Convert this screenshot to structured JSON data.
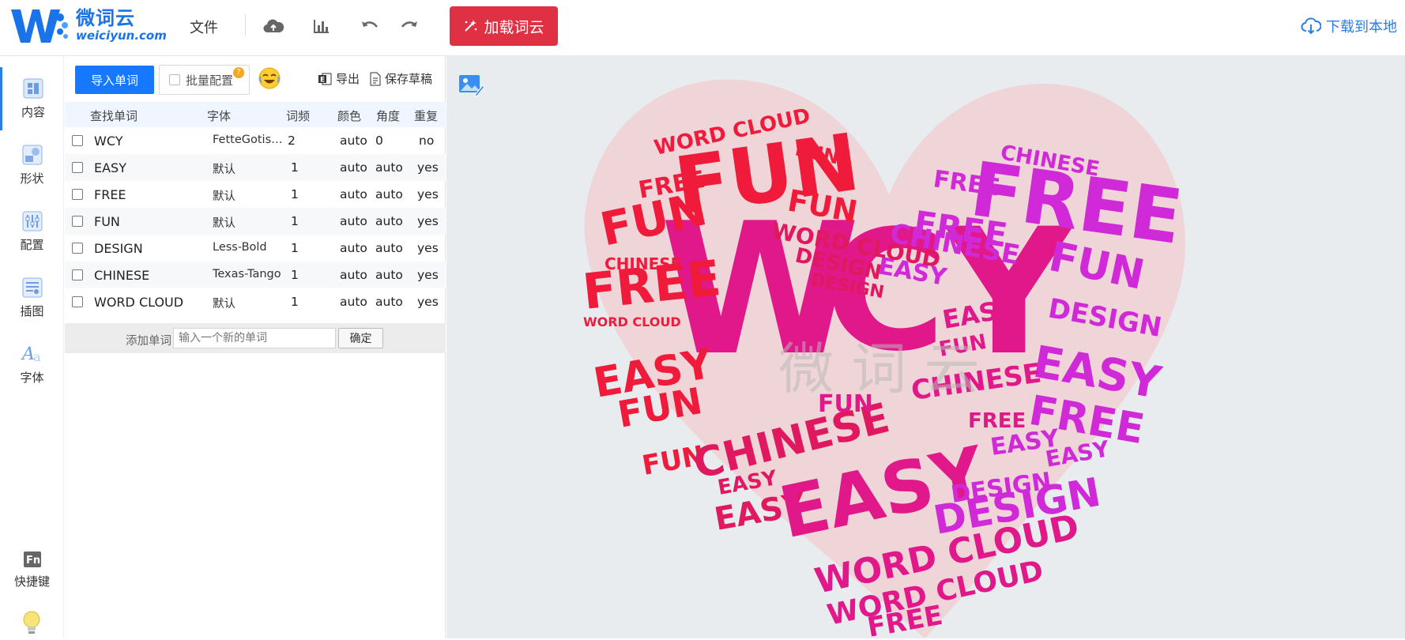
{
  "brand": {
    "name_cn": "微词云",
    "name_en": "weiciyun.com"
  },
  "toolbar": {
    "file_label": "文件",
    "load_button": "加载词云",
    "download_label": "下载到本地"
  },
  "sidenav": [
    {
      "label": "内容",
      "icon": "content-icon",
      "active": true
    },
    {
      "label": "形状",
      "icon": "shape-icon",
      "active": false
    },
    {
      "label": "配置",
      "icon": "settings-sliders-icon",
      "active": false
    },
    {
      "label": "插图",
      "icon": "illustration-icon",
      "active": false
    },
    {
      "label": "字体",
      "icon": "font-icon",
      "active": false
    },
    {
      "label": "快捷键",
      "icon": "shortcut-fn-icon",
      "active": false
    }
  ],
  "panel": {
    "import_button": "导入单词",
    "batch_label": "批量配置",
    "batch_help": "?",
    "export_label": "导出",
    "save_label": "保存草稿",
    "headers": {
      "word": "查找单词",
      "font": "字体",
      "freq": "词频",
      "color": "颜色",
      "angle": "角度",
      "repeat": "重复"
    },
    "rows": [
      {
        "word": "WCY",
        "font": "FetteGotisc...",
        "freq": "2",
        "color": "auto",
        "angle": "0",
        "repeat": "no"
      },
      {
        "word": "EASY",
        "font": "默认",
        "freq": "1",
        "color": "auto",
        "angle": "auto",
        "repeat": "yes"
      },
      {
        "word": "FREE",
        "font": "默认",
        "freq": "1",
        "color": "auto",
        "angle": "auto",
        "repeat": "yes"
      },
      {
        "word": "FUN",
        "font": "默认",
        "freq": "1",
        "color": "auto",
        "angle": "auto",
        "repeat": "yes"
      },
      {
        "word": "DESIGN",
        "font": "Less-Bold",
        "freq": "1",
        "color": "auto",
        "angle": "auto",
        "repeat": "yes"
      },
      {
        "word": "CHINESE",
        "font": "Texas-Tango",
        "freq": "1",
        "color": "auto",
        "angle": "auto",
        "repeat": "yes"
      },
      {
        "word": "WORD CLOUD",
        "font": "默认",
        "freq": "1",
        "color": "auto",
        "angle": "auto",
        "repeat": "yes"
      }
    ],
    "add_label": "添加单词",
    "add_placeholder": "输入一个新的单词",
    "add_confirm": "确定"
  },
  "canvas": {
    "shape": "heart",
    "watermark": "微词云",
    "colors": {
      "heart_fill": "#f0d5d8",
      "red": "#f01a3a",
      "pink": "#e0188a",
      "magenta": "#d02ad8",
      "accent_blue": "#2b7de9",
      "load_red": "#e03144"
    }
  }
}
